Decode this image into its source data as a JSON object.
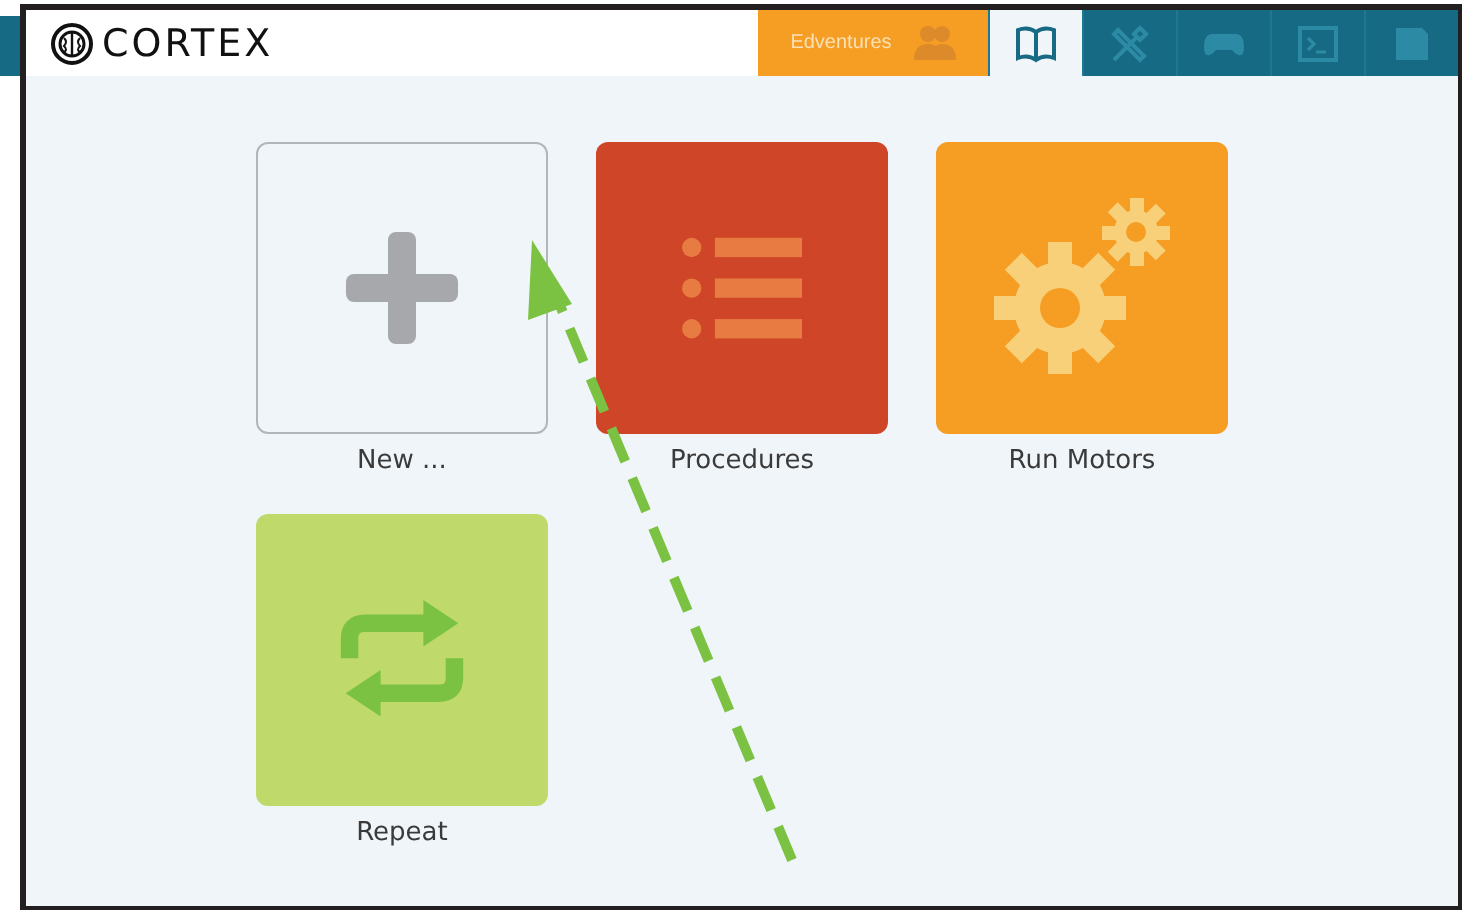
{
  "header": {
    "logo": "CORTEX",
    "tabs": [
      {
        "kind": "edventures",
        "label": "Edventures",
        "selected": false
      },
      {
        "kind": "book",
        "selected": true
      },
      {
        "kind": "tools",
        "selected": false
      },
      {
        "kind": "gamepad",
        "selected": false
      },
      {
        "kind": "terminal",
        "selected": false
      },
      {
        "kind": "save",
        "selected": false
      }
    ]
  },
  "tiles": [
    {
      "kind": "new",
      "label": "New ..."
    },
    {
      "kind": "list",
      "label": "Procedures"
    },
    {
      "kind": "gears",
      "label": "Run Motors"
    },
    {
      "kind": "repeat",
      "label": "Repeat"
    }
  ]
}
